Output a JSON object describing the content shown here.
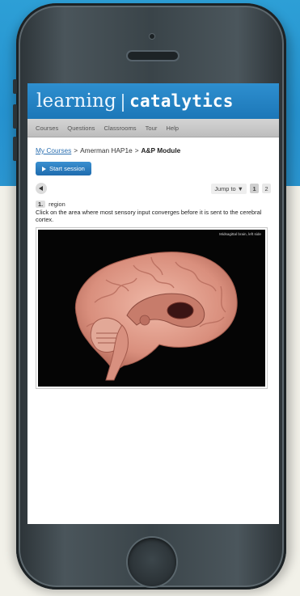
{
  "app": {
    "brand_light": "learning",
    "brand_sep": "|",
    "brand_bold": "catalytics"
  },
  "nav": {
    "items": [
      {
        "label": "Courses"
      },
      {
        "label": "Questions"
      },
      {
        "label": "Classrooms"
      },
      {
        "label": "Tour"
      },
      {
        "label": "Help"
      }
    ]
  },
  "breadcrumb": {
    "link": "My Courses",
    "sep1": ">",
    "middle": "Amerman HAP1e",
    "sep2": ">",
    "current": "A&P Module"
  },
  "session": {
    "start_label": "Start session"
  },
  "pager": {
    "jump_label": "Jump to ▼",
    "pages": [
      "1",
      "2"
    ],
    "active_page": "1"
  },
  "question": {
    "number": "1.",
    "type": "region",
    "text": "Click on the area where most sensory input converges before it is sent to the cerebral cortex."
  },
  "image": {
    "caption": "Midsagittal brain, left side"
  },
  "colors": {
    "brand_blue": "#1c77b8",
    "page_blue": "#2592cf",
    "cream": "#f2f1e9",
    "phone_body": "#3a4449"
  }
}
